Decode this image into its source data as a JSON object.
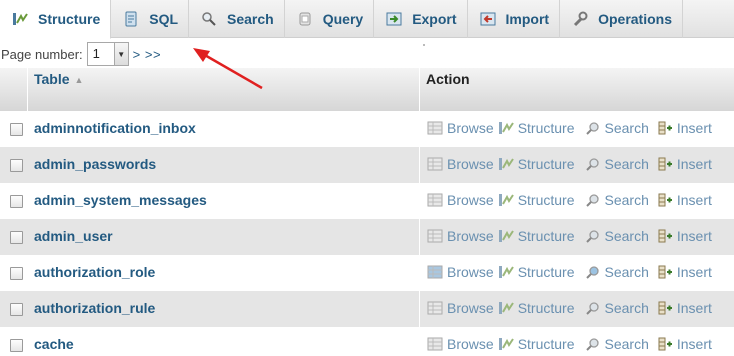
{
  "tabs": [
    {
      "label": "Structure",
      "icon": "structure-icon",
      "active": true
    },
    {
      "label": "SQL",
      "icon": "sql-icon",
      "active": false
    },
    {
      "label": "Search",
      "icon": "search-icon",
      "active": false
    },
    {
      "label": "Query",
      "icon": "query-icon",
      "active": false
    },
    {
      "label": "Export",
      "icon": "export-icon",
      "active": false
    },
    {
      "label": "Import",
      "icon": "import-icon",
      "active": false
    },
    {
      "label": "Operations",
      "icon": "operations-icon",
      "active": false
    }
  ],
  "pager": {
    "label": "Page number:",
    "selected": "1",
    "nav": "> >>"
  },
  "table": {
    "col_table": "Table",
    "col_action": "Action",
    "actions": {
      "browse": "Browse",
      "structure": "Structure",
      "search": "Search",
      "insert": "Insert"
    },
    "rows": [
      {
        "name": "adminnotification_inbox"
      },
      {
        "name": "admin_passwords"
      },
      {
        "name": "admin_system_messages"
      },
      {
        "name": "admin_user"
      },
      {
        "name": "authorization_role"
      },
      {
        "name": "authorization_rule"
      },
      {
        "name": "cache"
      }
    ]
  },
  "colors": {
    "link": "#235a81",
    "action_text": "#6a90b0",
    "row_alt": "#e5e5e5",
    "annotation_arrow": "#e02020"
  }
}
